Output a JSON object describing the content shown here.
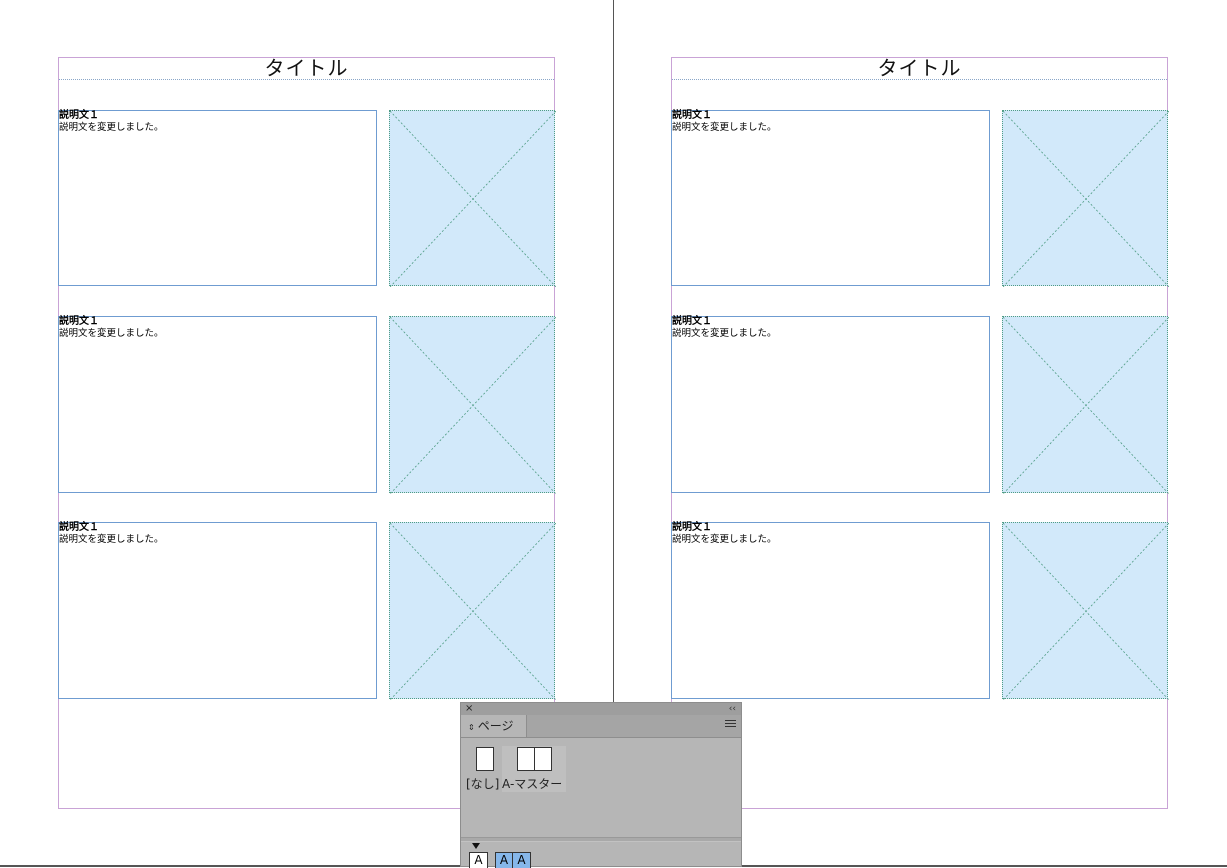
{
  "document": {
    "pages": [
      {
        "title": "タイトル",
        "blocks": [
          {
            "heading": "説明文１",
            "body": "説明文を変更しました。"
          },
          {
            "heading": "説明文１",
            "body": "説明文を変更しました。"
          },
          {
            "heading": "説明文１",
            "body": "説明文を変更しました。"
          }
        ]
      },
      {
        "title": "タイトル",
        "blocks": [
          {
            "heading": "説明文１",
            "body": "説明文を変更しました。"
          },
          {
            "heading": "説明文１",
            "body": "説明文を変更しました。"
          },
          {
            "heading": "説明文１",
            "body": "説明文を変更しました。"
          }
        ]
      }
    ]
  },
  "pages_panel": {
    "close_glyph": "×",
    "collapse_glyph": "‹‹",
    "tab_label": "ページ",
    "tab_glyph": "⇕",
    "masters": [
      {
        "label": "[なし]"
      },
      {
        "label": "A-マスター"
      }
    ],
    "page_thumbs": [
      {
        "label": "A"
      },
      {
        "label": "A"
      },
      {
        "label": "A"
      }
    ]
  },
  "colors": {
    "frame_border": "#6f9cd1",
    "image_fill": "#d2e9fa",
    "margin_guide": "#c9a3d6",
    "panel_bg": "#b6b6b6",
    "spread_selected": "#86b7ea"
  }
}
